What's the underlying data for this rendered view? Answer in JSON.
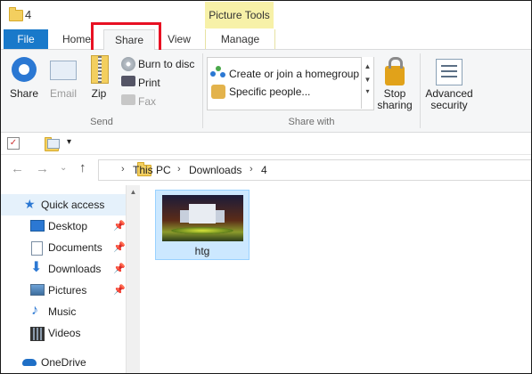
{
  "window": {
    "title": "4",
    "context_tab_group": "Picture Tools"
  },
  "tabs": [
    {
      "label": "File"
    },
    {
      "label": "Home"
    },
    {
      "label": "Share"
    },
    {
      "label": "View"
    },
    {
      "label": "Manage"
    }
  ],
  "ribbon": {
    "send": {
      "group_label": "Send",
      "share": "Share",
      "email": "Email",
      "zip": "Zip",
      "burn": "Burn to disc",
      "print": "Print",
      "fax": "Fax"
    },
    "share_with": {
      "group_label": "Share with",
      "homegroup": "Create or join a homegroup",
      "specific": "Specific people...",
      "stop_line1": "Stop",
      "stop_line2": "sharing"
    },
    "advanced": {
      "line1": "Advanced",
      "line2": "security"
    }
  },
  "address": {
    "breadcrumbs": [
      "This PC",
      "Downloads",
      "4"
    ]
  },
  "nav": {
    "quick_access": "Quick access",
    "items": [
      {
        "label": "Desktop"
      },
      {
        "label": "Documents"
      },
      {
        "label": "Downloads"
      },
      {
        "label": "Pictures"
      },
      {
        "label": "Music"
      },
      {
        "label": "Videos"
      }
    ],
    "onedrive": "OneDrive"
  },
  "files": [
    {
      "name": "htg"
    }
  ],
  "colors": {
    "file_tab": "#1979ca",
    "highlight": "#e81123",
    "picture_tools": "#f7f1a8",
    "selection": "#cce8ff"
  }
}
